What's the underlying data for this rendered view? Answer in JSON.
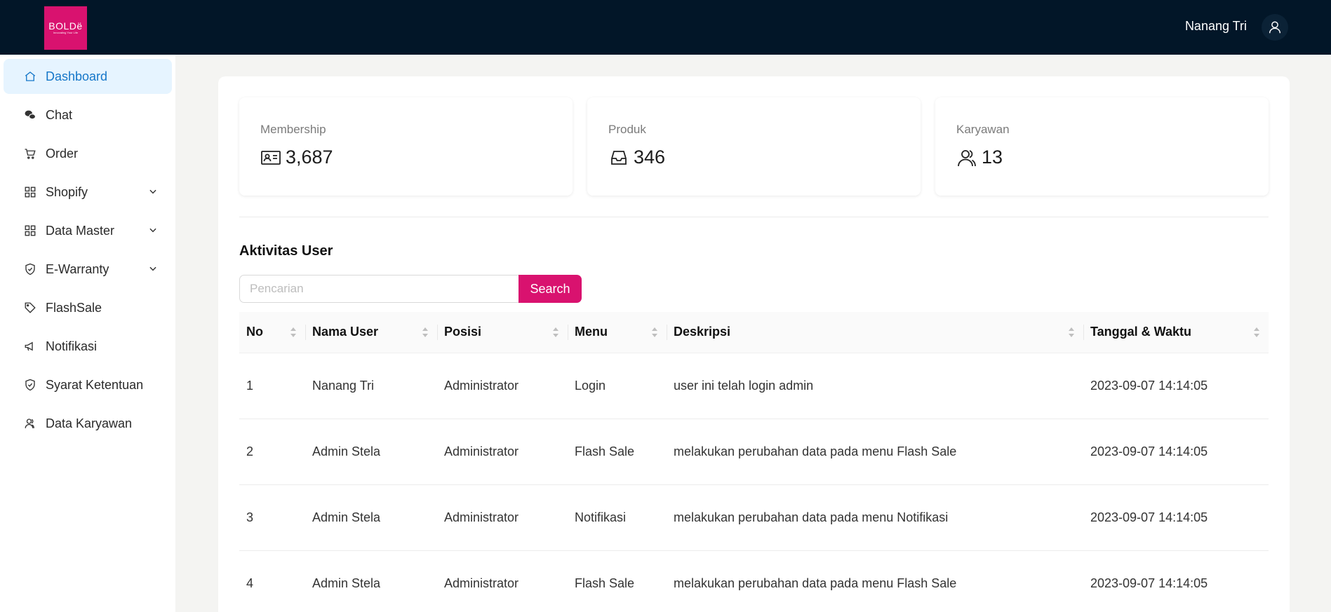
{
  "header": {
    "logo_text": "BOLDë",
    "logo_tagline": "Innovating Your Life",
    "user_name": "Nanang Tri",
    "user_icon": "user-icon"
  },
  "sidebar": {
    "items": [
      {
        "label": "Dashboard",
        "icon": "home-icon",
        "active": true
      },
      {
        "label": "Chat",
        "icon": "wechat-icon"
      },
      {
        "label": "Order",
        "icon": "cart-icon"
      },
      {
        "label": "Shopify",
        "icon": "grid-icon",
        "expandable": true
      },
      {
        "label": "Data Master",
        "icon": "grid-icon",
        "expandable": true
      },
      {
        "label": "E-Warranty",
        "icon": "shield-check-icon",
        "expandable": true
      },
      {
        "label": "FlashSale",
        "icon": "tag-icon"
      },
      {
        "label": "Notifikasi",
        "icon": "megaphone-icon"
      },
      {
        "label": "Syarat Ketentuan",
        "icon": "shield-check-icon"
      },
      {
        "label": "Data Karyawan",
        "icon": "users-icon"
      }
    ]
  },
  "stats": [
    {
      "label": "Membership",
      "value": "3,687",
      "icon": "id-card-icon"
    },
    {
      "label": "Produk",
      "value": "346",
      "icon": "inbox-icon"
    },
    {
      "label": "Karyawan",
      "value": "13",
      "icon": "team-icon"
    }
  ],
  "activity": {
    "title": "Aktivitas User",
    "search_placeholder": "Pencarian",
    "search_button": "Search",
    "columns": [
      "No",
      "Nama User",
      "Posisi",
      "Menu",
      "Deskripsi",
      "Tanggal & Waktu"
    ],
    "rows": [
      [
        "1",
        "Nanang Tri",
        "Administrator",
        "Login",
        "user ini telah login admin",
        "2023-09-07 14:14:05"
      ],
      [
        "2",
        "Admin Stela",
        "Administrator",
        "Flash Sale",
        "melakukan perubahan data pada menu Flash Sale",
        "2023-09-07 14:14:05"
      ],
      [
        "3",
        "Admin Stela",
        "Administrator",
        "Notifikasi",
        "melakukan perubahan data pada menu Notifikasi",
        "2023-09-07 14:14:05"
      ],
      [
        "4",
        "Admin Stela",
        "Administrator",
        "Flash Sale",
        "melakukan perubahan data pada menu Flash Sale",
        "2023-09-07 14:14:05"
      ]
    ]
  },
  "colors": {
    "topbar": "#021628",
    "accent": "#d9126f",
    "active_nav_bg": "#e6f4ff",
    "active_nav_text": "#1677c9"
  }
}
